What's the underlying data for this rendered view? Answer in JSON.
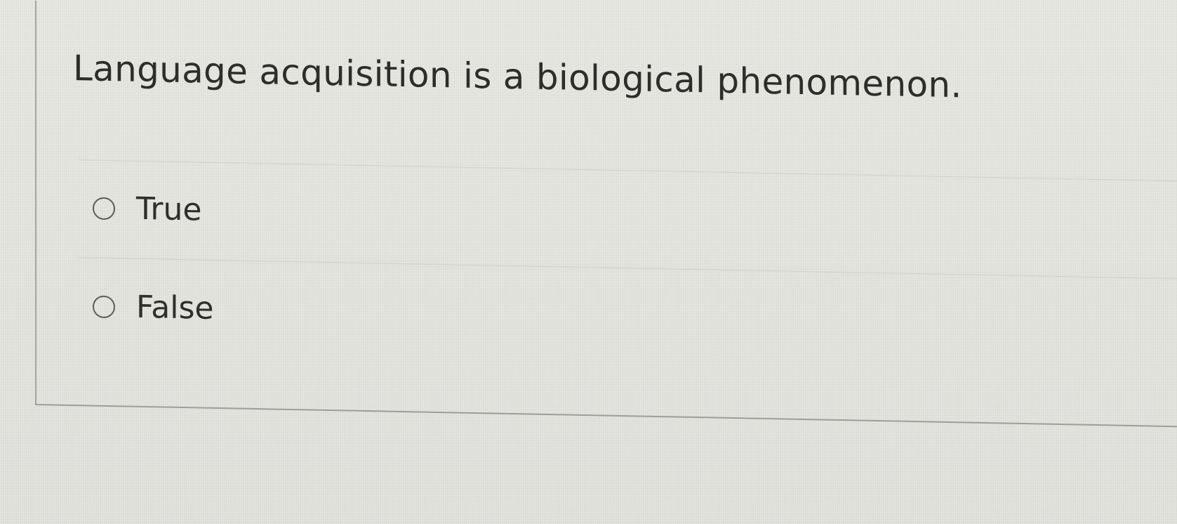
{
  "question": {
    "text": "Language acquisition is a biological phenomenon."
  },
  "options": [
    {
      "label": "True",
      "selected": false
    },
    {
      "label": "False",
      "selected": false
    }
  ],
  "colors": {
    "background": "#e6e7e1",
    "text": "#2d2e2b",
    "border": "#a4a5a0",
    "divider": "#cfd0cb"
  }
}
